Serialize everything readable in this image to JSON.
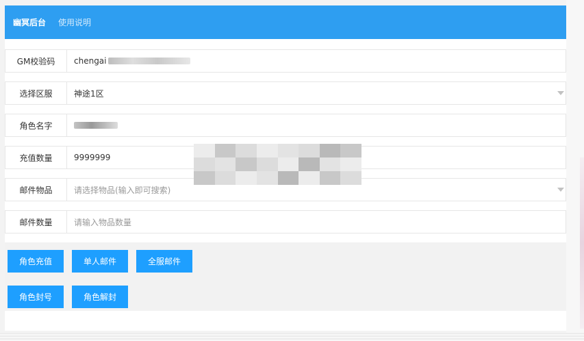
{
  "header": {
    "title": "幽冥后台",
    "nav_help": "使用说明"
  },
  "form": {
    "gm_code": {
      "label": "GM校验码",
      "value": "chengai"
    },
    "region": {
      "label": "选择区服",
      "value": "神途1区"
    },
    "role_name": {
      "label": "角色名字"
    },
    "recharge": {
      "label": "充值数量",
      "value": "9999999"
    },
    "mail_item": {
      "label": "邮件物品",
      "placeholder": "请选择物品(输入即可搜索)"
    },
    "mail_qty": {
      "label": "邮件数量",
      "placeholder": "请输入物品数量"
    }
  },
  "actions": {
    "role_recharge": "角色充值",
    "single_mail": "单人邮件",
    "server_mail": "全服邮件",
    "ban_role": "角色封号",
    "unban_role": "角色解封"
  },
  "colors": {
    "header_bg": "#2e9ef1",
    "button_bg": "#1e9fff",
    "action_bg": "#f2f2f2"
  }
}
